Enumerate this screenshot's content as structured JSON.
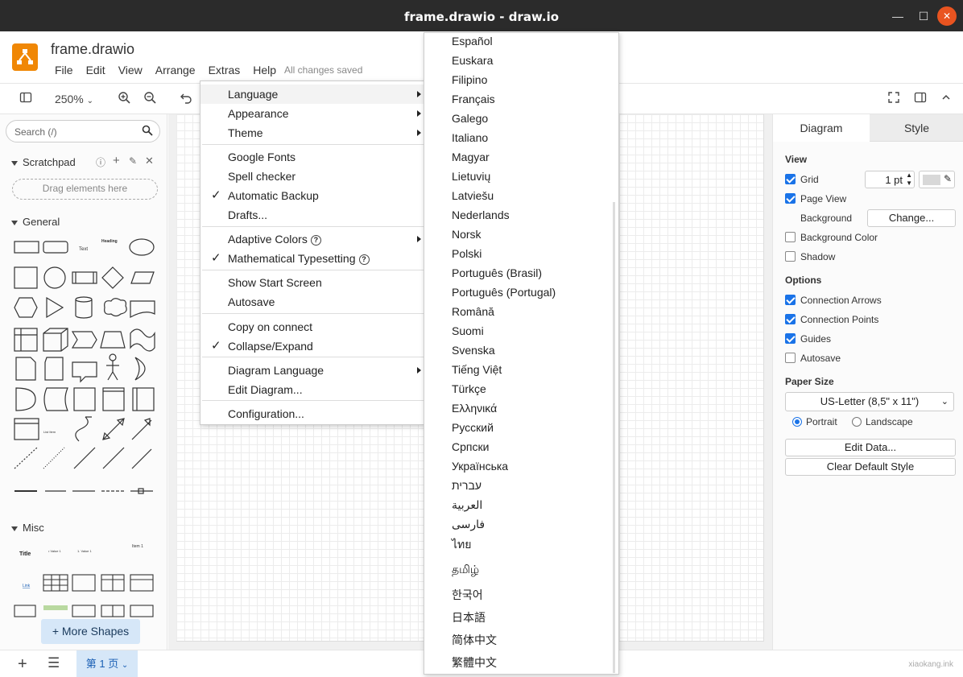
{
  "window": {
    "title": "frame.drawio - draw.io"
  },
  "header": {
    "doc_title": "frame.drawio",
    "menus": [
      "File",
      "Edit",
      "View",
      "Arrange",
      "Extras",
      "Help"
    ],
    "status": "All changes saved"
  },
  "toolbar": {
    "zoom": "250%"
  },
  "sidebar": {
    "search_placeholder": "Search (/)",
    "scratchpad_title": "Scratchpad",
    "drag_hint": "Drag elements here",
    "general_title": "General",
    "misc_title": "Misc",
    "more_shapes": "+ More Shapes"
  },
  "extras_menu": {
    "items": [
      {
        "label": "Language",
        "submenu": true
      },
      {
        "label": "Appearance",
        "submenu": true
      },
      {
        "label": "Theme",
        "submenu": true
      },
      {
        "label": "Google Fonts"
      },
      {
        "label": "Spell checker"
      },
      {
        "label": "Automatic Backup",
        "checked": true
      },
      {
        "label": "Drafts..."
      },
      {
        "label": "Adaptive Colors",
        "submenu": true,
        "help": true
      },
      {
        "label": "Mathematical Typesetting",
        "checked": true,
        "help": true
      },
      {
        "label": "Show Start Screen"
      },
      {
        "label": "Autosave"
      },
      {
        "label": "Copy on connect"
      },
      {
        "label": "Collapse/Expand",
        "checked": true
      },
      {
        "label": "Diagram Language",
        "submenu": true
      },
      {
        "label": "Edit Diagram..."
      },
      {
        "label": "Configuration..."
      }
    ]
  },
  "language_menu": {
    "items": [
      "Español",
      "Euskara",
      "Filipino",
      "Français",
      "Galego",
      "Italiano",
      "Magyar",
      "Lietuvių",
      "Latviešu",
      "Nederlands",
      "Norsk",
      "Polski",
      "Português (Brasil)",
      "Português (Portugal)",
      "Română",
      "Suomi",
      "Svenska",
      "Tiếng Việt",
      "Türkçe",
      "Ελληνικά",
      "Русский",
      "Српски",
      "Українська",
      "עברית",
      "العربية",
      "فارسی",
      "ไทย",
      "தமிழ்",
      "한국어",
      "日本語",
      "简体中文",
      "繁體中文"
    ]
  },
  "right_panel": {
    "tabs": [
      "Diagram",
      "Style"
    ],
    "view_title": "View",
    "grid_label": "Grid",
    "grid_size": "1 pt",
    "page_view_label": "Page View",
    "background_label": "Background",
    "change_button": "Change...",
    "background_color_label": "Background Color",
    "shadow_label": "Shadow",
    "options_title": "Options",
    "connection_arrows": "Connection Arrows",
    "connection_points": "Connection Points",
    "guides": "Guides",
    "autosave": "Autosave",
    "paper_size_title": "Paper Size",
    "paper_size": "US-Letter (8,5\" x 11\")",
    "portrait": "Portrait",
    "landscape": "Landscape",
    "edit_data": "Edit Data...",
    "clear_default_style": "Clear Default Style"
  },
  "bottom": {
    "page_tab": "第 1 页",
    "watermark": "xiaokang.ink"
  },
  "colors": {
    "accent": "#1a73e8",
    "logo": "#f08705",
    "titlebar": "#2b2b2b"
  }
}
